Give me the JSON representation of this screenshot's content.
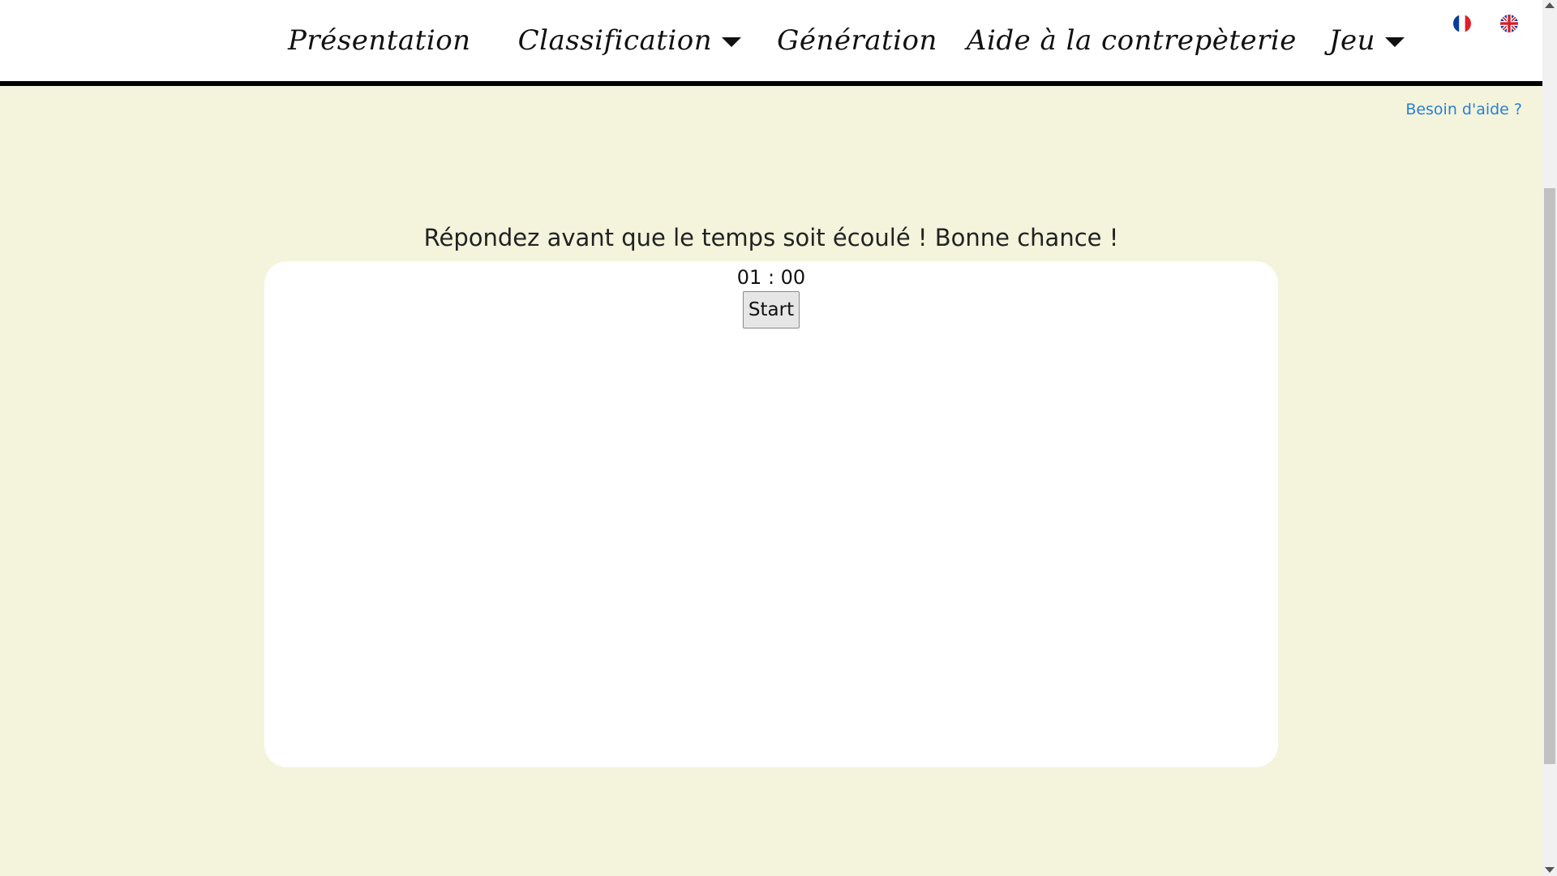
{
  "nav": {
    "items": [
      {
        "label": "Présentation",
        "has_dropdown": false,
        "icon": "chevron-down-icon"
      },
      {
        "label": "Classification",
        "has_dropdown": true,
        "icon": "chevron-down-icon"
      },
      {
        "label": "Génération",
        "has_dropdown": false,
        "icon": "chevron-down-icon"
      },
      {
        "label": "Aide à la contrepèterie",
        "has_dropdown": false,
        "icon": "chevron-down-icon"
      },
      {
        "label": "Jeu",
        "has_dropdown": true,
        "icon": "chevron-down-icon"
      }
    ],
    "languages": [
      {
        "code": "fr",
        "icon": "french-flag-icon"
      },
      {
        "code": "en",
        "icon": "uk-flag-icon"
      }
    ]
  },
  "help": {
    "label": "Besoin d'aide ?"
  },
  "game": {
    "instructions": "Répondez avant que le temps soit écoulé ! Bonne chance !",
    "timer": "01 : 00",
    "start_label": "Start"
  },
  "colors": {
    "background": "#f4f4dc",
    "link": "#2a7fd4",
    "navbar_border": "#000000",
    "card": "#ffffff"
  }
}
